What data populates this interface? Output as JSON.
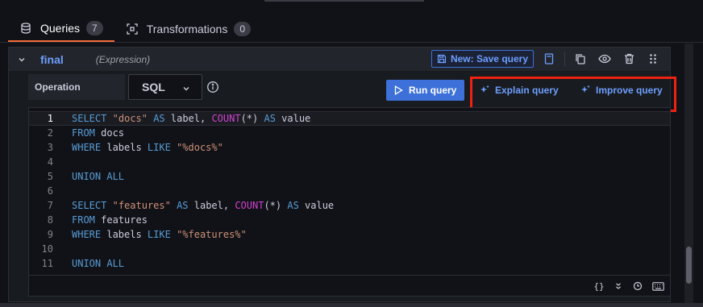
{
  "tabs": [
    {
      "label": "Queries",
      "count": "7"
    },
    {
      "label": "Transformations",
      "count": "0"
    }
  ],
  "query": {
    "name": "final",
    "type": "(Expression)",
    "save_label": "New: Save query"
  },
  "toolbar": {
    "operation_label": "Operation",
    "language": "SQL",
    "run_label": "Run query",
    "explain_label": "Explain query",
    "improve_label": "Improve query"
  },
  "editor": {
    "lines": [
      {
        "num": "1",
        "tokens": [
          [
            "kw",
            "SELECT"
          ],
          [
            "plain",
            " "
          ],
          [
            "str",
            "\"docs\""
          ],
          [
            "plain",
            " "
          ],
          [
            "kw",
            "AS"
          ],
          [
            "plain",
            " label, "
          ],
          [
            "fn",
            "COUNT"
          ],
          [
            "plain",
            "(*) "
          ],
          [
            "kw",
            "AS"
          ],
          [
            "plain",
            " value"
          ]
        ]
      },
      {
        "num": "2",
        "tokens": [
          [
            "kw",
            "FROM"
          ],
          [
            "plain",
            " docs"
          ]
        ]
      },
      {
        "num": "3",
        "tokens": [
          [
            "kw",
            "WHERE"
          ],
          [
            "plain",
            " labels "
          ],
          [
            "kw",
            "LIKE"
          ],
          [
            "plain",
            " "
          ],
          [
            "str",
            "\"%docs%\""
          ]
        ]
      },
      {
        "num": "4",
        "tokens": []
      },
      {
        "num": "5",
        "tokens": [
          [
            "kw",
            "UNION ALL"
          ]
        ]
      },
      {
        "num": "6",
        "tokens": []
      },
      {
        "num": "7",
        "tokens": [
          [
            "kw",
            "SELECT"
          ],
          [
            "plain",
            " "
          ],
          [
            "str",
            "\"features\""
          ],
          [
            "plain",
            " "
          ],
          [
            "kw",
            "AS"
          ],
          [
            "plain",
            " label, "
          ],
          [
            "fn",
            "COUNT"
          ],
          [
            "plain",
            "(*) "
          ],
          [
            "kw",
            "AS"
          ],
          [
            "plain",
            " value"
          ]
        ]
      },
      {
        "num": "8",
        "tokens": [
          [
            "kw",
            "FROM"
          ],
          [
            "plain",
            " features"
          ]
        ]
      },
      {
        "num": "9",
        "tokens": [
          [
            "kw",
            "WHERE"
          ],
          [
            "plain",
            " labels "
          ],
          [
            "kw",
            "LIKE"
          ],
          [
            "plain",
            " "
          ],
          [
            "str",
            "\"%features%\""
          ]
        ]
      },
      {
        "num": "10",
        "tokens": []
      },
      {
        "num": "11",
        "tokens": [
          [
            "kw",
            "UNION ALL"
          ]
        ]
      }
    ]
  },
  "colors": {
    "accent": "#3d71d9",
    "link": "#6e9fff",
    "highlight": "#ee2211",
    "active_tab": "#f46b38"
  },
  "icons": [
    "database-icon",
    "transform-icon",
    "chevron-down-icon",
    "save-icon",
    "book-icon",
    "duplicate-icon",
    "eye-icon",
    "trash-icon",
    "drag-handle-icon",
    "info-icon",
    "play-icon",
    "sparkle-icon",
    "braces-icon",
    "collapse-icon",
    "history-icon",
    "keyboard-icon"
  ]
}
